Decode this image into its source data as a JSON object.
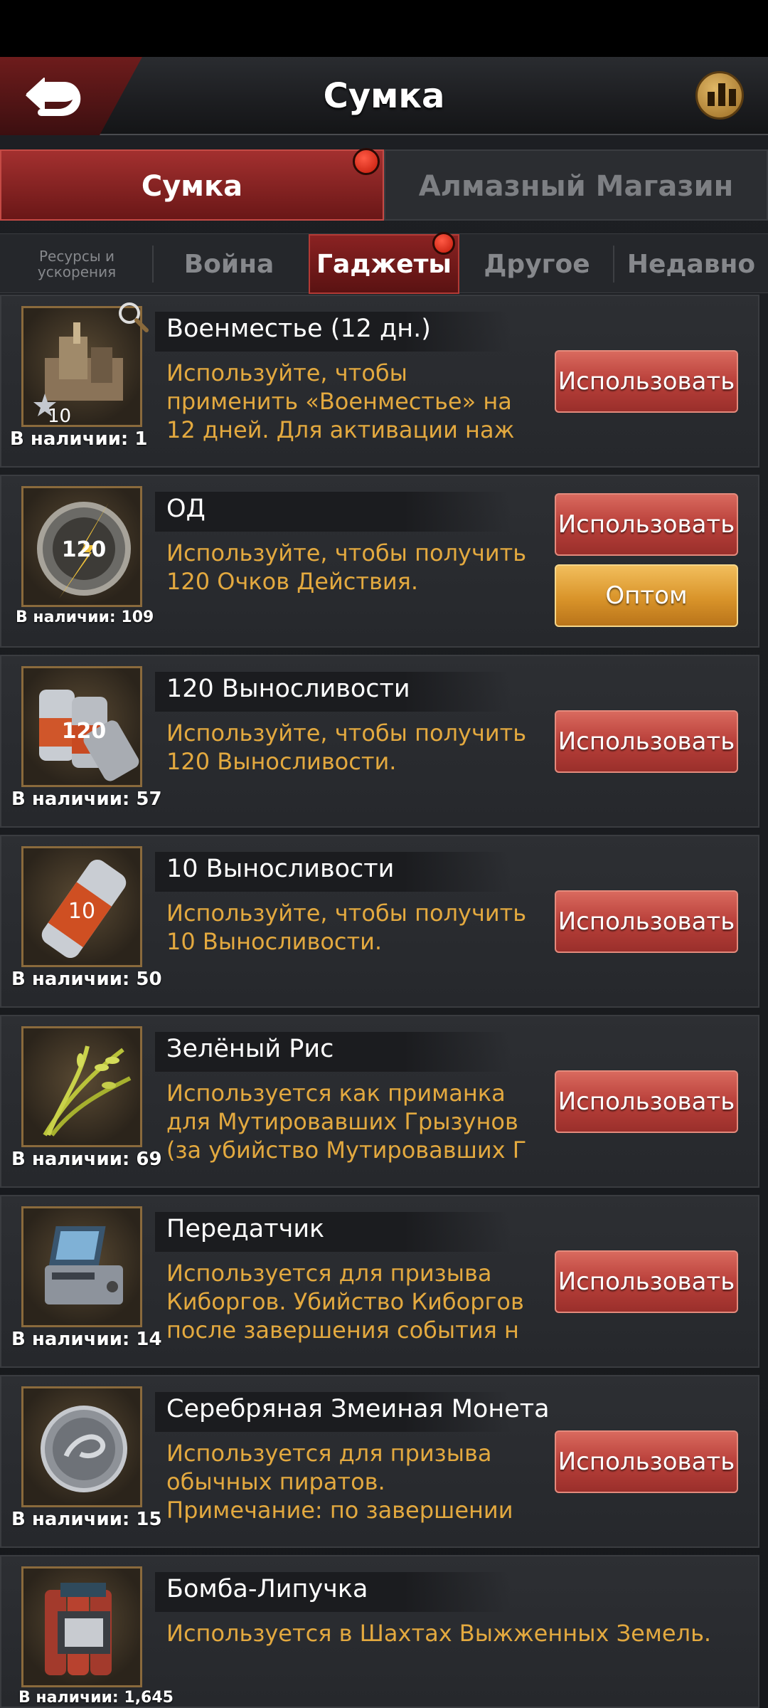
{
  "header": {
    "title": "Сумка"
  },
  "main_tabs": [
    {
      "label": "Сумка",
      "active": true,
      "badge": true
    },
    {
      "label": "Алмазный Магазин",
      "active": false,
      "badge": false
    }
  ],
  "sub_tabs": [
    {
      "label": "Ресурсы и ускорения",
      "active": false
    },
    {
      "label": "Война",
      "active": false
    },
    {
      "label": "Гаджеты",
      "active": true,
      "badge": true
    },
    {
      "label": "Другое",
      "active": false
    },
    {
      "label": "Недавно",
      "active": false
    }
  ],
  "items": [
    {
      "name": "Военместье (12 дн.)",
      "icon": "war-city-icon",
      "icon_badge": "10",
      "qty": "В наличии: 1",
      "desc": [
        "Используйте, чтобы",
        "применить «Военместье» на",
        "12 дней. Для активации наж"
      ],
      "buttons": [
        "Использовать"
      ]
    },
    {
      "name": "ОД",
      "icon": "action-points-icon",
      "icon_badge": "120",
      "qty": "В наличии: 109",
      "desc": [
        "Используйте, чтобы получить",
        "120 Очков Действия."
      ],
      "buttons": [
        "Использовать",
        "Оптом"
      ]
    },
    {
      "name": "120 Выносливости",
      "icon": "stamina-cans-icon",
      "icon_badge": "120",
      "qty": "В наличии: 57",
      "desc": [
        "Используйте, чтобы получить",
        "120 Выносливости."
      ],
      "buttons": [
        "Использовать"
      ]
    },
    {
      "name": "10 Выносливости",
      "icon": "stamina-can-icon",
      "icon_badge": "10",
      "qty": "В наличии: 50",
      "desc": [
        "Используйте, чтобы получить",
        "10 Выносливости."
      ],
      "buttons": [
        "Использовать"
      ]
    },
    {
      "name": "Зелёный Рис",
      "icon": "green-rice-icon",
      "icon_badge": "",
      "qty": "В наличии: 69",
      "desc": [
        "Используется как приманка",
        "для Мутировавших Грызунов",
        "(за убийство Мутировавших Г"
      ],
      "buttons": [
        "Использовать"
      ]
    },
    {
      "name": "Передатчик",
      "icon": "transmitter-icon",
      "icon_badge": "",
      "qty": "В наличии: 14",
      "desc": [
        "Используется для призыва",
        "Киборгов. Убийство Киборгов",
        "после завершения события н"
      ],
      "buttons": [
        "Использовать"
      ]
    },
    {
      "name": "Серебряная Змеиная Монета",
      "icon": "silver-snake-coin-icon",
      "icon_badge": "",
      "qty": "В наличии: 15",
      "desc": [
        "Используется для призыва",
        "обычных пиратов.",
        "Примечание: по завершении"
      ],
      "buttons": [
        "Использовать"
      ]
    },
    {
      "name": "Бомба-Липучка",
      "icon": "sticky-bomb-icon",
      "icon_badge": "",
      "qty": "В наличии: 1,645",
      "desc": [
        "Используется в Шахтах Выжженных Земель."
      ],
      "buttons": []
    }
  ],
  "colors": {
    "accent_red": "#b9403a",
    "accent_orange": "#d9942a",
    "desc_text": "#e3a93f",
    "badge_red": "#e0341e"
  }
}
